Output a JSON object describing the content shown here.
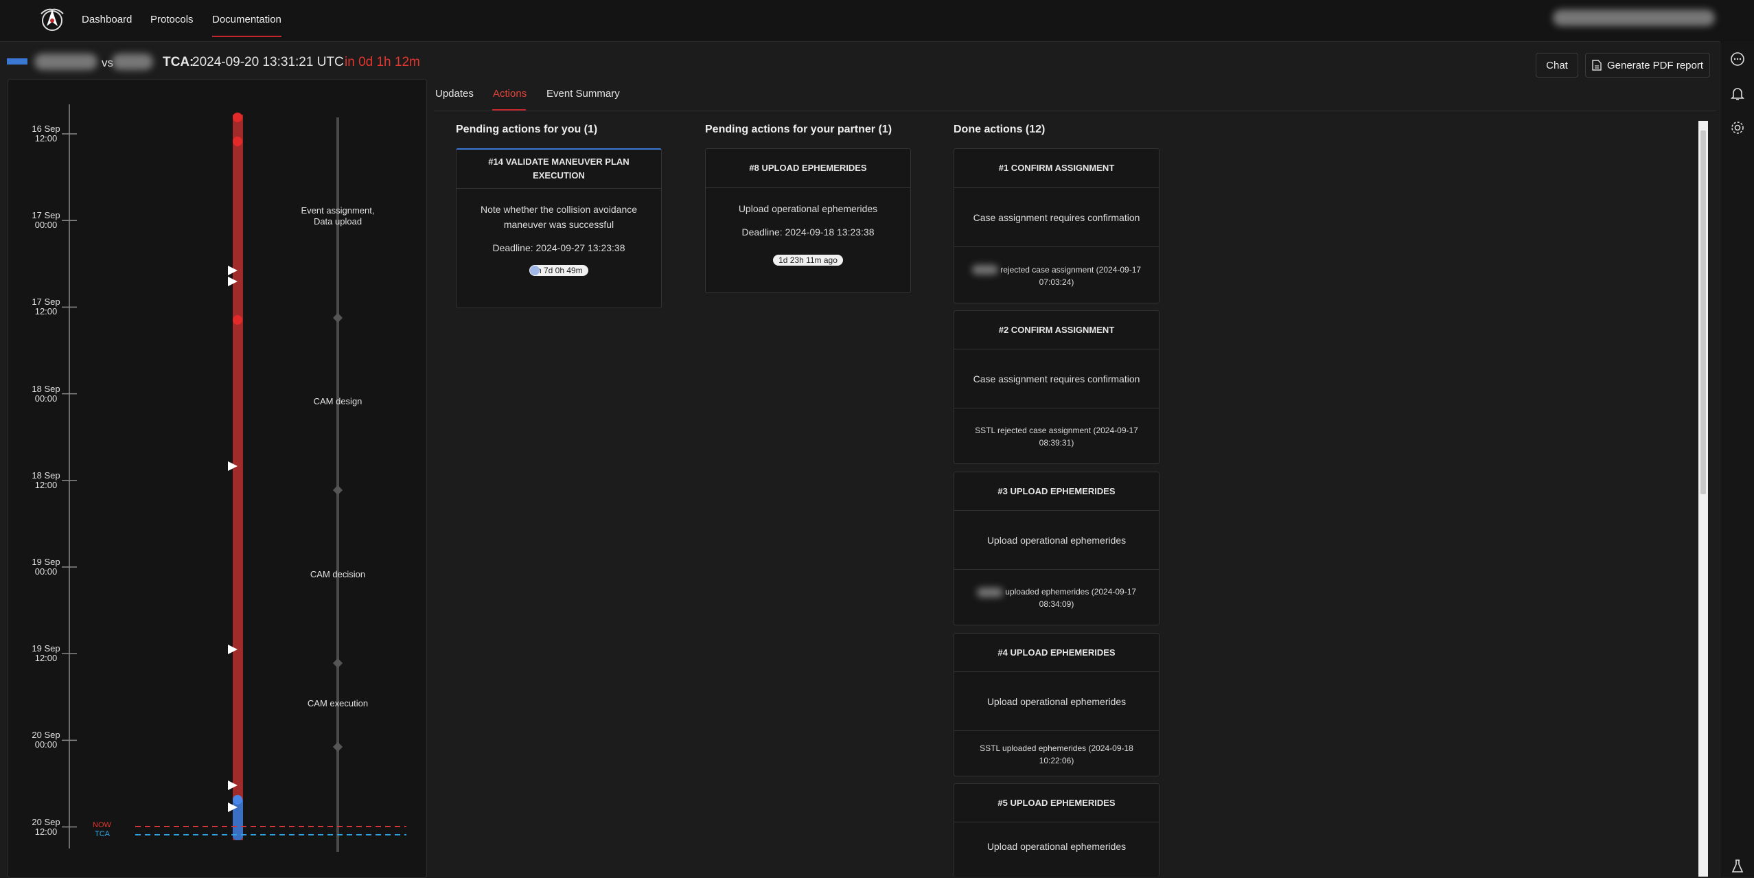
{
  "nav": {
    "items": [
      "Dashboard",
      "Protocols",
      "Documentation"
    ],
    "active": "Documentation"
  },
  "event": {
    "separator": "vs",
    "tca_label": "TCA:",
    "tca_value": "2024-09-20 13:31:21 UTC",
    "countdown": "in 0d 1h 12m"
  },
  "actions_bar": {
    "chat": "Chat",
    "pdf": "Generate PDF report"
  },
  "tabs": [
    "Updates",
    "Actions",
    "Event Summary"
  ],
  "timeline": {
    "ticks": [
      {
        "d": "16 Sep",
        "t": "12:00"
      },
      {
        "d": "17 Sep",
        "t": "00:00"
      },
      {
        "d": "17 Sep",
        "t": "12:00"
      },
      {
        "d": "18 Sep",
        "t": "00:00"
      },
      {
        "d": "18 Sep",
        "t": "12:00"
      },
      {
        "d": "19 Sep",
        "t": "00:00"
      },
      {
        "d": "19 Sep",
        "t": "12:00"
      },
      {
        "d": "20 Sep",
        "t": "00:00"
      },
      {
        "d": "20 Sep",
        "t": "12:00"
      }
    ],
    "phases": [
      "Event assignment,\nData upload",
      "CAM design",
      "CAM decision",
      "CAM execution"
    ],
    "now_label": "NOW",
    "tca_label": "TCA"
  },
  "columns": {
    "pending_you": {
      "title": "Pending actions for you (1)",
      "cards": [
        {
          "title": "#14 VALIDATE MANEUVER PLAN EXECUTION",
          "body": "Note whether the collision avoidance maneuver was successful",
          "deadline": "Deadline: 2024-09-27 13:23:38",
          "pill": "in 7d 0h 49m"
        }
      ]
    },
    "pending_partner": {
      "title": "Pending actions for your partner (1)",
      "cards": [
        {
          "title": "#8 UPLOAD EPHEMERIDES",
          "body": "Upload operational ephemerides",
          "deadline": "Deadline: 2024-09-18 13:23:38",
          "pill": "1d 23h 11m ago"
        }
      ]
    },
    "done": {
      "title": "Done actions (12)",
      "cards": [
        {
          "title": "#1 CONFIRM ASSIGNMENT",
          "body": "Case assignment requires confirmation",
          "footer": "rejected case assignment (2024-09-17 07:03:24)"
        },
        {
          "title": "#2 CONFIRM ASSIGNMENT",
          "body": "Case assignment requires confirmation",
          "footer": "SSTL rejected case assignment (2024-09-17 08:39:31)"
        },
        {
          "title": "#3 UPLOAD EPHEMERIDES",
          "body": "Upload operational ephemerides",
          "footer": "uploaded ephemerides (2024-09-17 08:34:09)"
        },
        {
          "title": "#4 UPLOAD EPHEMERIDES",
          "body": "Upload operational ephemerides",
          "footer": "SSTL uploaded ephemerides (2024-09-18 10:22:06)"
        },
        {
          "title": "#5 UPLOAD EPHEMERIDES",
          "body": "Upload operational ephemerides"
        }
      ]
    }
  },
  "colors": {
    "accent": "#c4262e",
    "blue": "#3a78d4",
    "now_line": "#d6343a",
    "tca_line": "#2fa3df"
  }
}
